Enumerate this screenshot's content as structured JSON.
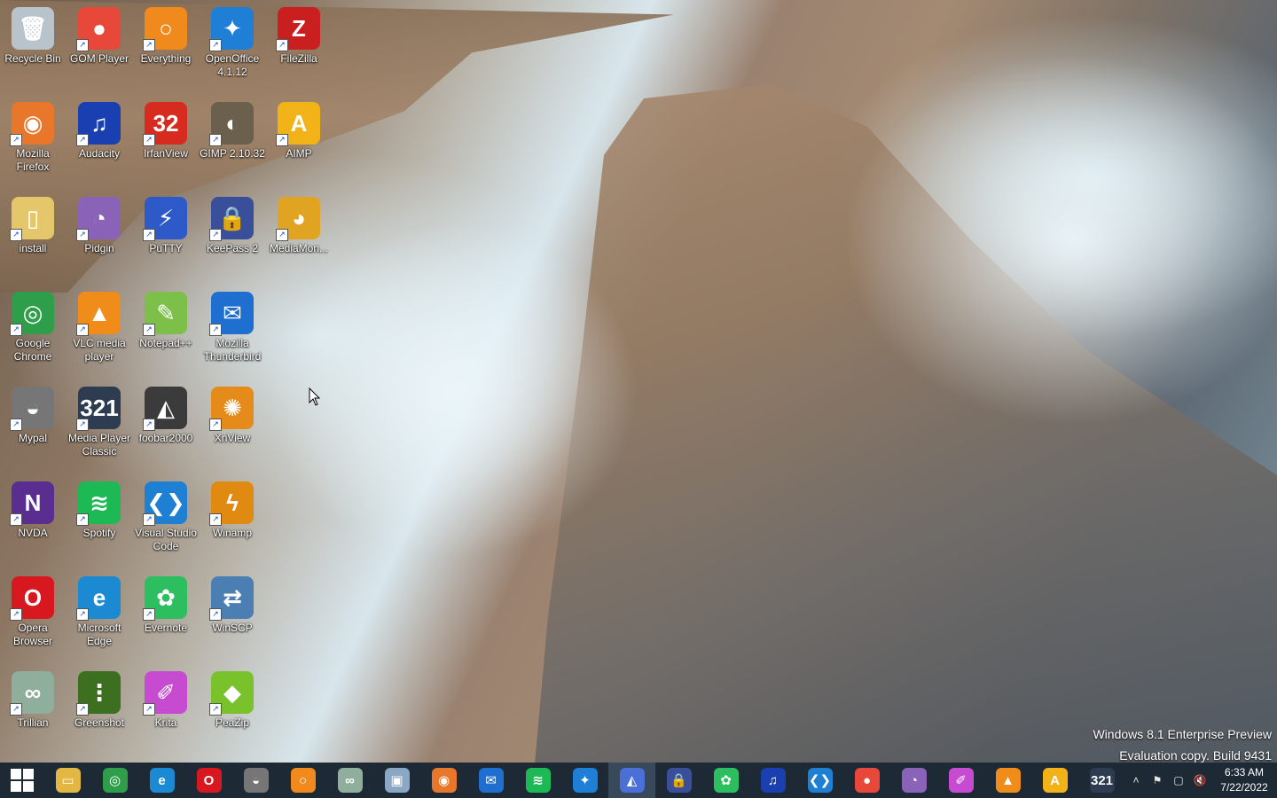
{
  "desktop": {
    "icons": [
      {
        "label": "Recycle Bin",
        "name": "recycle-bin-icon",
        "color": "#b9c3cc",
        "glyph": "🗑"
      },
      {
        "label": "GOM Player",
        "name": "gom-player-icon",
        "color": "#e8483a",
        "glyph": "●"
      },
      {
        "label": "Everything",
        "name": "everything-icon",
        "color": "#f08a1c",
        "glyph": "○"
      },
      {
        "label": "OpenOffice 4.1.12",
        "name": "openoffice-icon",
        "color": "#1f7fd6",
        "glyph": "✦"
      },
      {
        "label": "FileZilla",
        "name": "filezilla-icon",
        "color": "#c9201f",
        "glyph": "Z"
      },
      {
        "label": "Mozilla Firefox",
        "name": "firefox-icon",
        "color": "#e8762b",
        "glyph": "◉"
      },
      {
        "label": "Audacity",
        "name": "audacity-icon",
        "color": "#1a3fb0",
        "glyph": "♫"
      },
      {
        "label": "IrfanView",
        "name": "irfanview-icon",
        "color": "#d62b1e",
        "glyph": "32"
      },
      {
        "label": "GIMP 2.10.32",
        "name": "gimp-icon",
        "color": "#6b5f4d",
        "glyph": "◐"
      },
      {
        "label": "AIMP",
        "name": "aimp-icon",
        "color": "#f2b319",
        "glyph": "A"
      },
      {
        "label": "install",
        "name": "install-folder-icon",
        "color": "#e5c76b",
        "glyph": "▯"
      },
      {
        "label": "Pidgin",
        "name": "pidgin-icon",
        "color": "#8a63b8",
        "glyph": "◔"
      },
      {
        "label": "PuTTY",
        "name": "putty-icon",
        "color": "#2d59c9",
        "glyph": "⚡"
      },
      {
        "label": "KeePass 2",
        "name": "keepass-icon",
        "color": "#3a4f9a",
        "glyph": "🔒"
      },
      {
        "label": "MediaMon...",
        "name": "mediamonkey-icon",
        "color": "#e0a422",
        "glyph": "◕"
      },
      {
        "label": "Google Chrome",
        "name": "chrome-icon",
        "color": "#2f9e4a",
        "glyph": "◎"
      },
      {
        "label": "VLC media player",
        "name": "vlc-icon",
        "color": "#f08c1a",
        "glyph": "▲"
      },
      {
        "label": "Notepad++",
        "name": "notepadpp-icon",
        "color": "#7cc04a",
        "glyph": "✎"
      },
      {
        "label": "Mozilla Thunderbird",
        "name": "thunderbird-icon",
        "color": "#1f6fd0",
        "glyph": "✉"
      },
      {
        "label": "Mypal",
        "name": "mypal-icon",
        "color": "#767676",
        "glyph": "◒"
      },
      {
        "label": "Media Player Classic",
        "name": "mpc-icon",
        "color": "#2e3c52",
        "glyph": "321"
      },
      {
        "label": "foobar2000",
        "name": "foobar2000-icon",
        "color": "#3b3b3b",
        "glyph": "◭"
      },
      {
        "label": "XnView",
        "name": "xnview-icon",
        "color": "#e48b1a",
        "glyph": "✺"
      },
      {
        "label": "NVDA",
        "name": "nvda-icon",
        "color": "#5a2d91",
        "glyph": "N"
      },
      {
        "label": "Spotify",
        "name": "spotify-icon",
        "color": "#1db954",
        "glyph": "≋"
      },
      {
        "label": "Visual Studio Code",
        "name": "vscode-icon",
        "color": "#1e7fd3",
        "glyph": "❮❯"
      },
      {
        "label": "Winamp",
        "name": "winamp-icon",
        "color": "#e08a12",
        "glyph": "ϟ"
      },
      {
        "label": "Opera Browser",
        "name": "opera-icon",
        "color": "#d7191f",
        "glyph": "O"
      },
      {
        "label": "Microsoft Edge",
        "name": "edge-icon",
        "color": "#1b8ad2",
        "glyph": "e"
      },
      {
        "label": "Evernote",
        "name": "evernote-icon",
        "color": "#2dbe60",
        "glyph": "✿"
      },
      {
        "label": "WinSCP",
        "name": "winscp-icon",
        "color": "#4b7fb3",
        "glyph": "⇄"
      },
      {
        "label": "Trillian",
        "name": "trillian-icon",
        "color": "#8fae9c",
        "glyph": "∞"
      },
      {
        "label": "Greenshot",
        "name": "greenshot-icon",
        "color": "#3c6f1f",
        "glyph": "⋮"
      },
      {
        "label": "Krita",
        "name": "krita-icon",
        "color": "#c64bd0",
        "glyph": "✐"
      },
      {
        "label": "PeaZip",
        "name": "peazip-icon",
        "color": "#7ac22c",
        "glyph": "◆"
      }
    ]
  },
  "watermark": {
    "line1": "Windows 8.1 Enterprise Preview",
    "line2": "Evaluation copy. Build 9431"
  },
  "taskbar": {
    "pinned": [
      {
        "name": "taskbar-file-explorer-icon",
        "color": "#e3b743",
        "glyph": "▭"
      },
      {
        "name": "taskbar-chrome-icon",
        "color": "#2f9e4a",
        "glyph": "◎"
      },
      {
        "name": "taskbar-edge-icon",
        "color": "#1b8ad2",
        "glyph": "e"
      },
      {
        "name": "taskbar-opera-icon",
        "color": "#d7191f",
        "glyph": "O"
      },
      {
        "name": "taskbar-mypal-icon",
        "color": "#767676",
        "glyph": "◒"
      },
      {
        "name": "taskbar-everything-icon",
        "color": "#f08a1c",
        "glyph": "○"
      },
      {
        "name": "taskbar-trillian-icon",
        "color": "#8fae9c",
        "glyph": "∞"
      },
      {
        "name": "taskbar-monitor-icon",
        "color": "#8aa7c4",
        "glyph": "▣"
      },
      {
        "name": "taskbar-firefox-icon",
        "color": "#e8762b",
        "glyph": "◉"
      },
      {
        "name": "taskbar-thunderbird-icon",
        "color": "#1f6fd0",
        "glyph": "✉"
      },
      {
        "name": "taskbar-spotify-icon",
        "color": "#1db954",
        "glyph": "≋"
      },
      {
        "name": "taskbar-openoffice-icon",
        "color": "#1f7fd6",
        "glyph": "✦"
      },
      {
        "name": "taskbar-active-app-icon",
        "color": "#4a6fd6",
        "glyph": "◭",
        "active": true
      },
      {
        "name": "taskbar-keepass-icon",
        "color": "#3a4f9a",
        "glyph": "🔒"
      },
      {
        "name": "taskbar-evernote-icon",
        "color": "#2dbe60",
        "glyph": "✿"
      },
      {
        "name": "taskbar-audacity-icon",
        "color": "#1a3fb0",
        "glyph": "♫"
      },
      {
        "name": "taskbar-vscode-icon",
        "color": "#1e7fd3",
        "glyph": "❮❯"
      },
      {
        "name": "taskbar-gom-player-icon",
        "color": "#e8483a",
        "glyph": "●"
      },
      {
        "name": "taskbar-pidgin-icon",
        "color": "#8a63b8",
        "glyph": "◔"
      },
      {
        "name": "taskbar-krita-icon",
        "color": "#c64bd0",
        "glyph": "✐"
      },
      {
        "name": "taskbar-vlc-icon",
        "color": "#f08c1a",
        "glyph": "▲"
      },
      {
        "name": "taskbar-aimp-icon",
        "color": "#f2b319",
        "glyph": "A"
      },
      {
        "name": "taskbar-mpc-icon",
        "color": "#2e3c52",
        "glyph": "321"
      }
    ],
    "tray": {
      "chevron": "˄",
      "flag": "⚑",
      "network": "▢",
      "volume": "🔇"
    },
    "clock": {
      "time": "6:33 AM",
      "date": "7/22/2022"
    }
  }
}
